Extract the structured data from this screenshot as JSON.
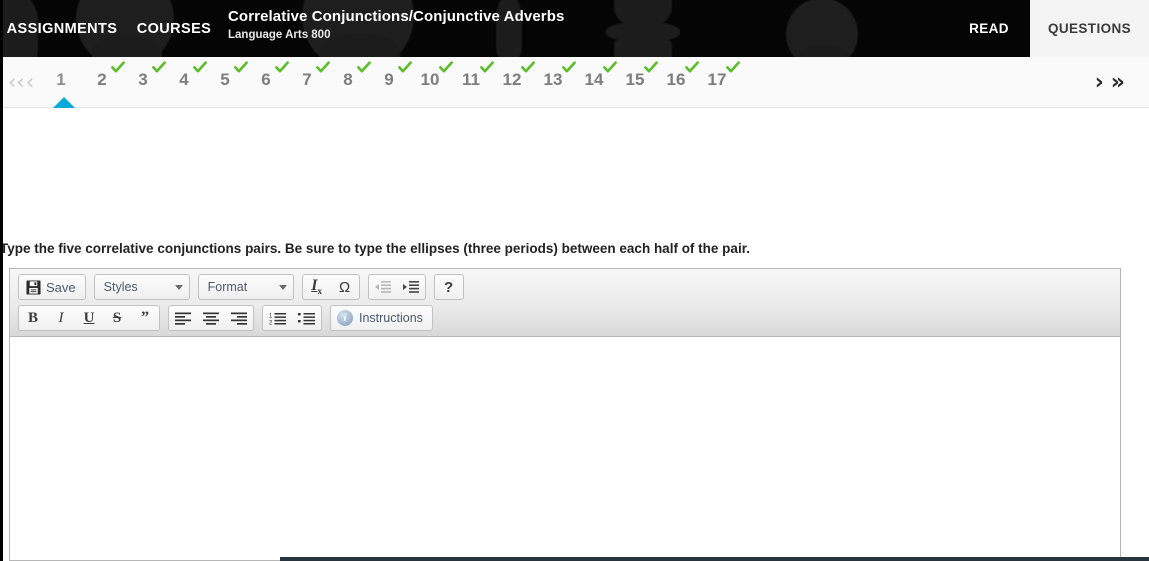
{
  "header": {
    "assignments_label": "ASSIGNMENTS",
    "courses_label": "COURSES",
    "title": "Correlative Conjunctions/Conjunctive Adverbs",
    "subtitle": "Language Arts 800",
    "read_tab_label": "READ",
    "questions_tab_label": "QUESTIONS",
    "active_tab": "QUESTIONS"
  },
  "question_nav": {
    "prev_all_icon": "chevron-double-left-icon",
    "prev_icon": "chevron-left-icon",
    "next_icon": "chevron-right-icon",
    "next_all_icon": "chevron-double-right-icon",
    "prev_disabled": true,
    "items": [
      {
        "number": "1",
        "completed": false,
        "active": true
      },
      {
        "number": "2",
        "completed": true,
        "active": false
      },
      {
        "number": "3",
        "completed": true,
        "active": false
      },
      {
        "number": "4",
        "completed": true,
        "active": false
      },
      {
        "number": "5",
        "completed": true,
        "active": false
      },
      {
        "number": "6",
        "completed": true,
        "active": false
      },
      {
        "number": "7",
        "completed": true,
        "active": false
      },
      {
        "number": "8",
        "completed": true,
        "active": false
      },
      {
        "number": "9",
        "completed": true,
        "active": false
      },
      {
        "number": "10",
        "completed": true,
        "active": false
      },
      {
        "number": "11",
        "completed": true,
        "active": false
      },
      {
        "number": "12",
        "completed": true,
        "active": false
      },
      {
        "number": "13",
        "completed": true,
        "active": false
      },
      {
        "number": "14",
        "completed": true,
        "active": false
      },
      {
        "number": "15",
        "completed": true,
        "active": false
      },
      {
        "number": "16",
        "completed": true,
        "active": false
      },
      {
        "number": "17",
        "completed": true,
        "active": false
      }
    ]
  },
  "question": {
    "prompt": "Type the five correlative conjunctions pairs. Be sure to type the ellipses (three periods) between each half of the pair."
  },
  "editor": {
    "row1": {
      "save_label": "Save",
      "save_icon": "floppy-disk-icon",
      "styles_label": "Styles",
      "format_label": "Format",
      "remove_format_label": "I",
      "remove_format_sub": "x",
      "special_char_label": "Ω",
      "outdent_icon": "decrease-indent-icon",
      "indent_icon": "increase-indent-icon",
      "help_label": "?"
    },
    "row2": {
      "bold_label": "B",
      "italic_label": "I",
      "underline_label": "U",
      "strike_label": "S",
      "blockquote_label": "”",
      "align_left_icon": "align-left-icon",
      "align_center_icon": "align-center-icon",
      "align_right_icon": "align-right-icon",
      "numbered_list_icon": "numbered-list-icon",
      "bulleted_list_icon": "bulleted-list-icon",
      "instructions_label": "Instructions",
      "instructions_icon": "info-icon"
    },
    "body_value": ""
  },
  "colors": {
    "header_bg": "#050505",
    "active_tab_bg": "#f4f4f4",
    "check_green": "#5bbd2a",
    "active_marker": "#0aabd6",
    "nav_bg": "#fafafa",
    "bottom_bar": "#27333d"
  }
}
